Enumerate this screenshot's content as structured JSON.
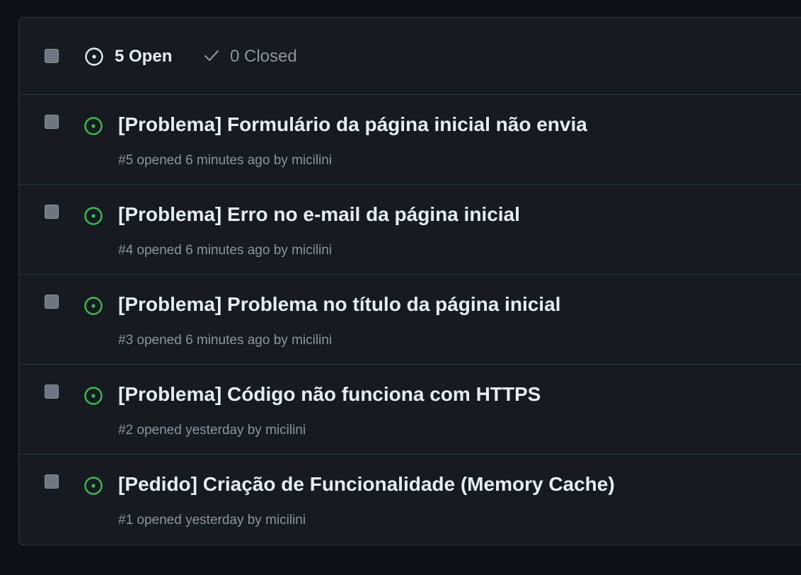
{
  "header": {
    "open_label": "5 Open",
    "closed_label": "0 Closed"
  },
  "issues": [
    {
      "title": "[Problema] Formulário da página inicial não envia",
      "meta": "#5 opened 6 minutes ago by micilini"
    },
    {
      "title": "[Problema] Erro no e-mail da página inicial",
      "meta": "#4 opened 6 minutes ago by micilini"
    },
    {
      "title": "[Problema] Problema no título da página inicial",
      "meta": "#3 opened 6 minutes ago by micilini"
    },
    {
      "title": "[Problema] Código não funciona com HTTPS",
      "meta": "#2 opened yesterday by micilini"
    },
    {
      "title": "[Pedido] Criação de Funcionalidade (Memory Cache)",
      "meta": "#1 opened yesterday by micilini"
    }
  ],
  "colors": {
    "background": "#0d1117",
    "panel": "#161b22",
    "border": "#30363d",
    "open_green": "#3fb950",
    "text_primary": "#e6edf3",
    "text_muted": "#8b949e"
  }
}
